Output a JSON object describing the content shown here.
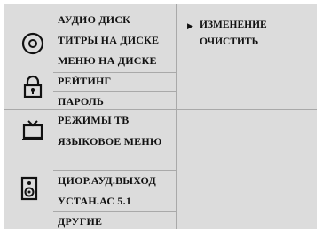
{
  "menu": {
    "disc": [
      "АУДИО ДИСК",
      "ТИТРЫ НА ДИСКЕ",
      "МЕНЮ НА ДИСКЕ"
    ],
    "lock": [
      "РЕЙТИНГ",
      "ПАРОЛЬ"
    ],
    "tv": [
      "РЕЖИМЫ ТВ",
      "ЯЗЫКОВОЕ МЕНЮ"
    ],
    "speaker": [
      "ЦИОР.АУД.ВЫХОД",
      "УСТАН.АС 5.1"
    ],
    "other": [
      "ДРУГИЕ"
    ]
  },
  "submenu": [
    {
      "label": "ИЗМЕНЕНИЕ",
      "marker": "▶"
    },
    {
      "label": "ОЧИСТИТЬ",
      "marker": ""
    }
  ],
  "colors": {
    "panel": "#dcdcdc",
    "separator": "#a9a9a9",
    "text": "#111111"
  },
  "icons": [
    "disc-icon",
    "padlock-icon",
    "tv-icon",
    "speaker-icon"
  ]
}
